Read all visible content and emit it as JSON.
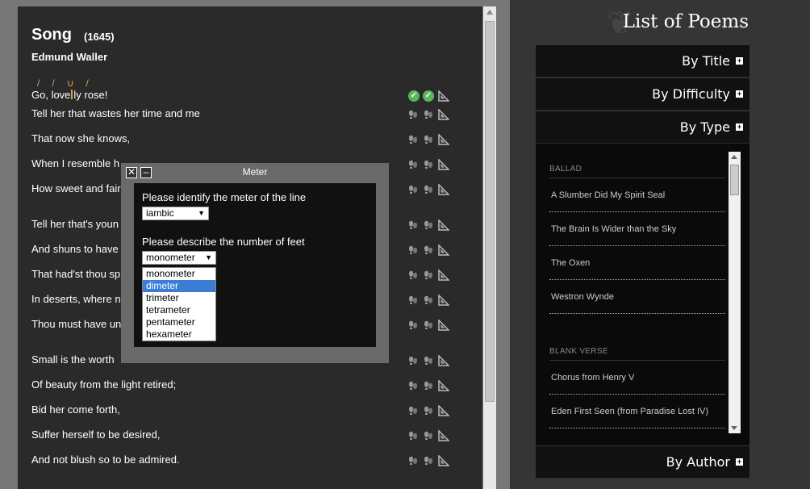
{
  "poem": {
    "title": "Song",
    "year": "(1645)",
    "author": "Edmund Waller",
    "scansion": [
      "/",
      "/",
      "∪",
      "/"
    ],
    "first_line_a": "Go, love",
    "first_line_b": "ly rose!",
    "lines": [
      "Tell her that wastes her time and me",
      "That now she knows,",
      "When I resemble h",
      "How sweet and fair",
      "Tell her that's youn",
      "And shuns to have",
      "That had'st thou sp",
      "In deserts, where n",
      "Thou must have un",
      "Small is the worth",
      "Of beauty from the light retired;",
      "Bid her come forth,",
      "Suffer herself to be desired,",
      "And not blush so to be admired."
    ]
  },
  "dialog": {
    "title": "Meter",
    "close_label": "✕",
    "minimize_label": "–",
    "q1": "Please identify the meter of the line",
    "meter_value": "iambic",
    "q2": "Please describe the number of feet",
    "feet_value": "monometer",
    "feet_options": [
      "monometer",
      "dimeter",
      "trimeter",
      "tetrameter",
      "pentameter",
      "hexameter"
    ],
    "highlighted_option": "dimeter"
  },
  "sidebar": {
    "title": "List of Poems",
    "by_title": "By Title",
    "by_difficulty": "By Difficulty",
    "by_type": "By Type",
    "by_author": "By Author",
    "categories": [
      {
        "name": "BALLAD",
        "items": [
          "A Slumber Did My Spirit Seal",
          "The Brain Is Wider than the Sky",
          "The Oxen",
          "Westron Wynde"
        ]
      },
      {
        "name": "BLANK VERSE",
        "items": [
          "Chorus from Henry V",
          "Eden First Seen (from Paradise Lost IV)"
        ]
      }
    ]
  },
  "icons": {
    "scan": "footprint-icon",
    "check": "check-circle-icon",
    "measure": "set-square-icon"
  },
  "colors": {
    "accent": "#e0a050",
    "check": "#5bb55b",
    "highlight": "#3b7cd4"
  }
}
